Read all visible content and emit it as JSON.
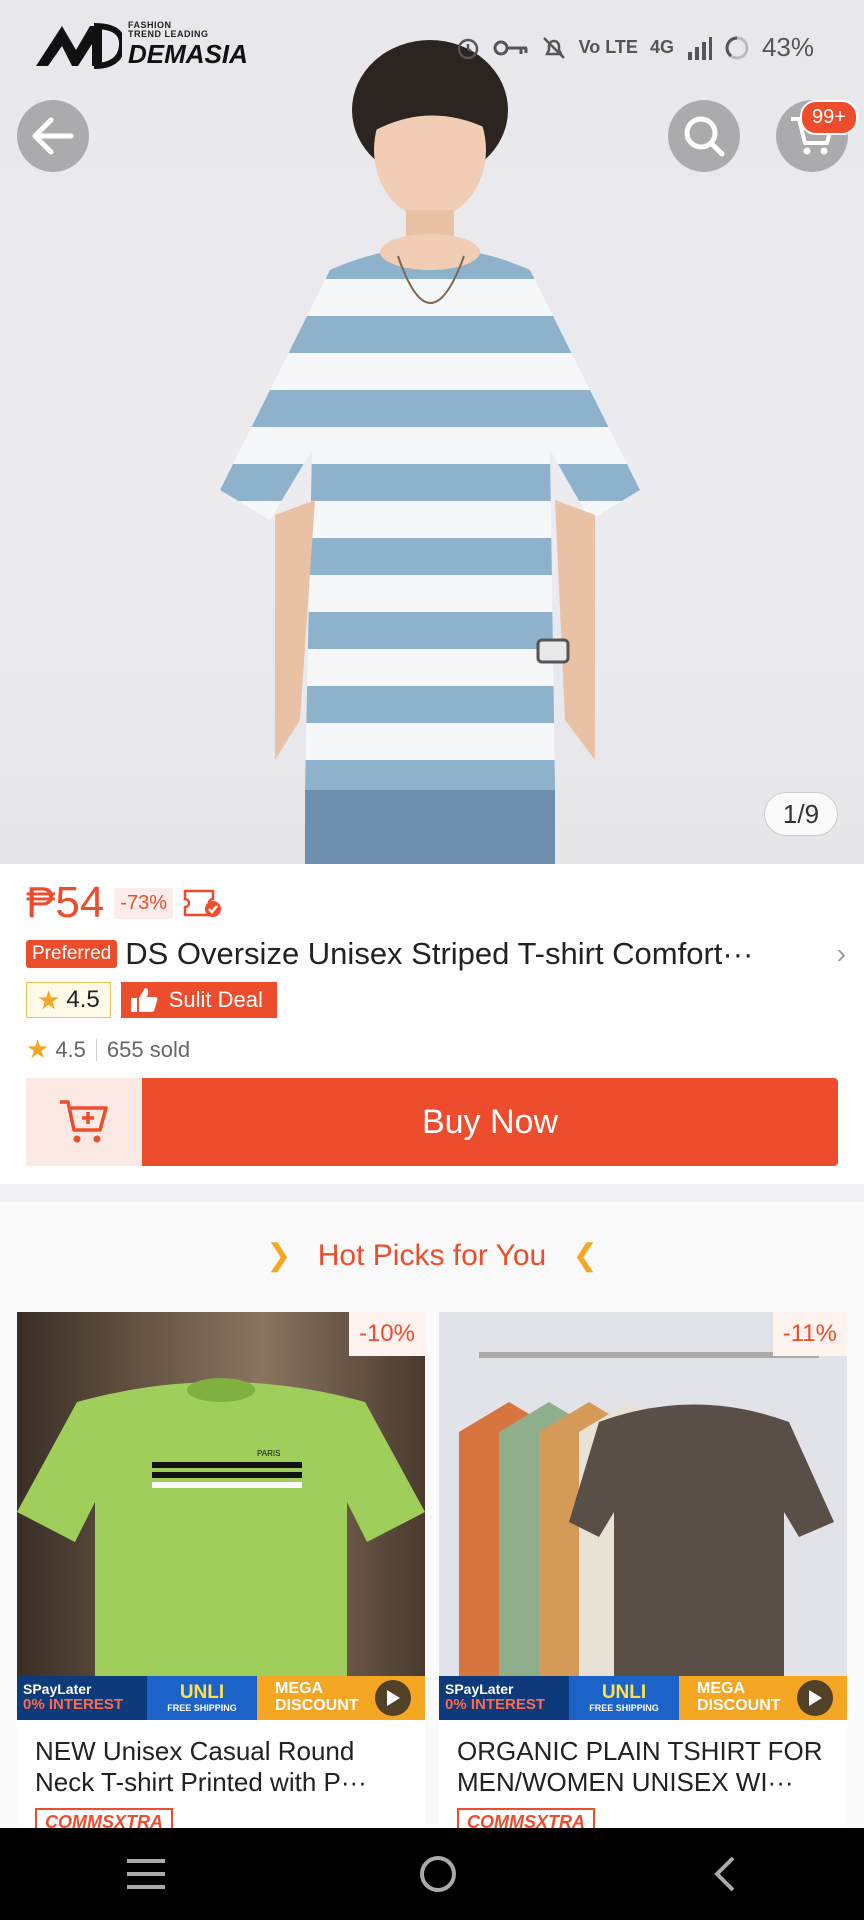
{
  "status_bar": {
    "network": "4G",
    "volte": "Vo LTE",
    "battery": "43%"
  },
  "brand": {
    "tagline_1": "FASHION",
    "tagline_2": "TREND LEADING",
    "name": "DEMASIA"
  },
  "header": {
    "cart_badge": "99+",
    "image_counter": "1/9"
  },
  "product": {
    "price": "₱54",
    "discount": "-73%",
    "preferred_label": "Preferred",
    "title": "DS Oversize Unisex Striped T-shirt Comfort···",
    "badge_rating": "4.5",
    "sulit_label": "Sulit Deal",
    "rating": "4.5",
    "sold": "655 sold",
    "buy_now_label": "Buy Now"
  },
  "hot_picks": {
    "title": "Hot Picks for You",
    "items": [
      {
        "discount": "-10%",
        "title": "NEW Unisex Casual Round Neck T-shirt Printed with P···",
        "tag": "COMMSXTRA"
      },
      {
        "discount": "-11%",
        "title": "ORGANIC PLAIN TSHIRT FOR MEN/WOMEN UNISEX  WI···",
        "tag": "COMMSXTRA"
      }
    ],
    "promo": {
      "spaylater": "SPayLater",
      "interest": "0% INTEREST",
      "unli": "UNLI",
      "free_shipping": "FREE SHIPPING",
      "mega_1": "MEGA",
      "mega_2": "DISCOUNT"
    },
    "print_text": "PARIS"
  },
  "colors": {
    "accent": "#ee4d2d",
    "stripe_blue": "#8fb2cc",
    "tee_green": "#9fcf5a"
  }
}
